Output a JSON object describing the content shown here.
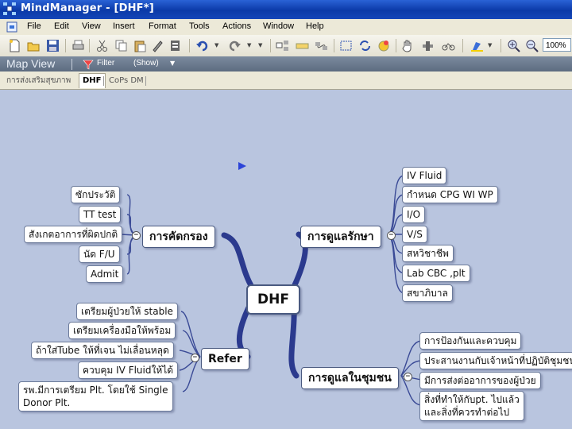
{
  "window": {
    "title": "MindManager - [DHF*]"
  },
  "menu": [
    "File",
    "Edit",
    "View",
    "Insert",
    "Format",
    "Tools",
    "Actions",
    "Window",
    "Help"
  ],
  "toolbar": {
    "zoom": "100%"
  },
  "mapview": {
    "title": "Map View",
    "filter_label": "Filter",
    "show_label": "(Show)"
  },
  "tabs": [
    "การส่งเสริมสุขภาพ",
    "DHF",
    "CoPs DM"
  ],
  "map": {
    "central": "DHF",
    "screening": {
      "label": "การคัดกรอง",
      "children": [
        "ซักประวัติ",
        "TT test",
        "สังเกตอาการที่ผิดปกติ",
        "นัด F/U",
        "Admit"
      ]
    },
    "care": {
      "label": "การดูแลรักษา",
      "children": [
        "IV Fluid",
        "กำหนด CPG  WI  WP",
        "I/O",
        "V/S",
        "สหวิชาชีพ",
        "Lab  CBC ,plt",
        "สขาภิบาล"
      ]
    },
    "refer": {
      "label": "Refer",
      "children": [
        "เตรียมผู้ป่วยให้ stable",
        "เตรียมเครื่องมือให้พร้อม",
        "ถ้าใส่Tube ให้ที่เจน  ไม่เลื่อนหลุด",
        "ควบคุม IV Fluidให้ได้",
        "รพ.มีการเตรียม Plt. โดยใช้ Single\nDonor Plt."
      ]
    },
    "community": {
      "label": "การดูแลในชุมชน",
      "children": [
        "การป้องกันและควบคุม",
        "ประสานงานกับเจ้าหน้าที่ปฏิบัติชุมชน",
        "มีการส่งต่ออาการของผู้ป่วย",
        "สิ่งที่ทำให้กับpt. ไปแล้ว\nและสิ่งที่ควรทำต่อไป"
      ]
    }
  }
}
